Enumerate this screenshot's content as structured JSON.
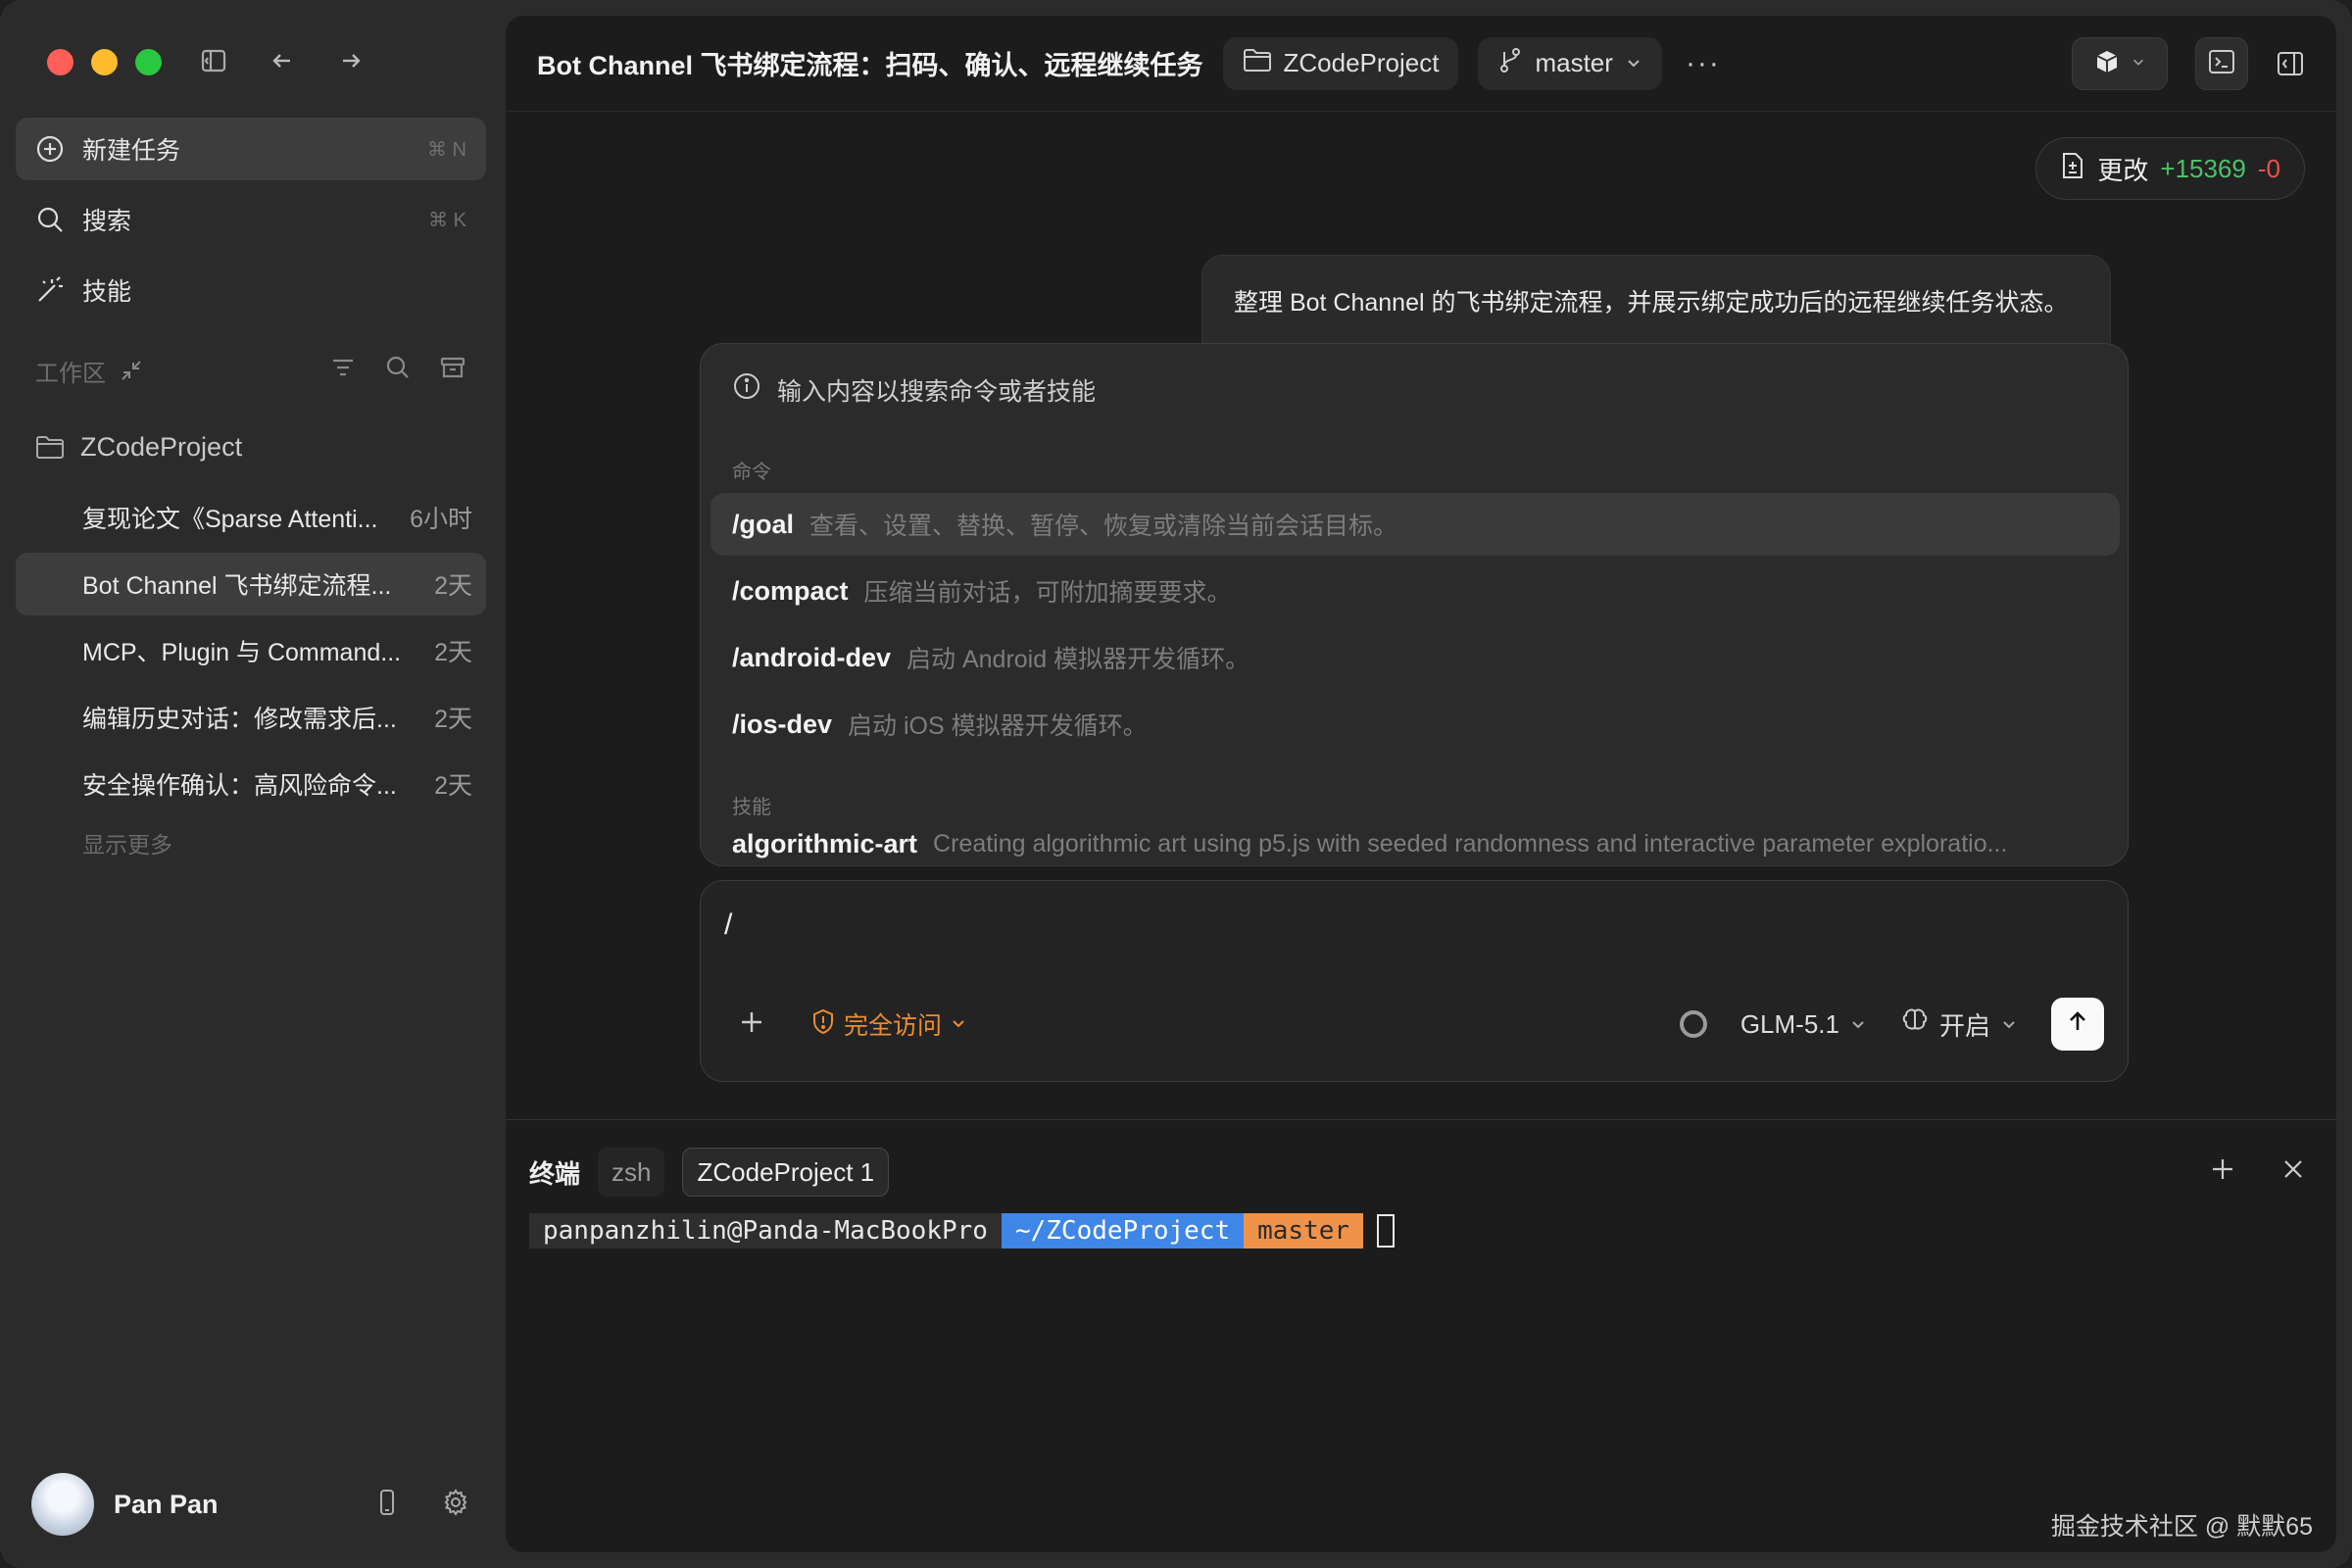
{
  "sidebar": {
    "nav": [
      {
        "label": "新建任务",
        "shortcut": "⌘ N",
        "icon": "plus-circle-icon"
      },
      {
        "label": "搜索",
        "shortcut": "⌘ K",
        "icon": "search-icon"
      },
      {
        "label": "技能",
        "shortcut": "",
        "icon": "magic-wand-icon"
      }
    ],
    "section_label": "工作区",
    "project": "ZCodeProject",
    "tasks": [
      {
        "title": "复现论文《Sparse Attenti...",
        "time": "6小时"
      },
      {
        "title": "Bot Channel 飞书绑定流程...",
        "time": "2天"
      },
      {
        "title": "MCP、Plugin 与 Command...",
        "time": "2天"
      },
      {
        "title": "编辑历史对话：修改需求后...",
        "time": "2天"
      },
      {
        "title": "安全操作确认：高风险命令...",
        "time": "2天"
      }
    ],
    "show_more": "显示更多",
    "user": {
      "name": "Pan Pan"
    }
  },
  "topbar": {
    "title": "Bot Channel 飞书绑定流程：扫码、确认、远程继续任务",
    "project": "ZCodeProject",
    "branch": "master",
    "more": "···"
  },
  "changes": {
    "label": "更改",
    "added": "+15369",
    "removed": "-0"
  },
  "user_message": "整理 Bot Channel 的飞书绑定流程，并展示绑定成功后的远程继续任务状态。",
  "palette": {
    "hint": "输入内容以搜索命令或者技能",
    "commands_label": "命令",
    "commands": [
      {
        "name": "/goal",
        "desc": "查看、设置、替换、暂停、恢复或清除当前会话目标。"
      },
      {
        "name": "/compact",
        "desc": "压缩当前对话，可附加摘要要求。"
      },
      {
        "name": "/android-dev",
        "desc": "启动 Android 模拟器开发循环。"
      },
      {
        "name": "/ios-dev",
        "desc": "启动 iOS 模拟器开发循环。"
      }
    ],
    "skills_label": "技能",
    "skills": [
      {
        "name": "algorithmic-art",
        "desc": "Creating algorithmic art using p5.js with seeded randomness and interactive parameter exploratio..."
      }
    ]
  },
  "composer": {
    "value": "/",
    "access": "完全访问",
    "model": "GLM-5.1",
    "thinking": "开启"
  },
  "terminal": {
    "title": "终端",
    "tabs": [
      "zsh",
      "ZCodeProject 1"
    ],
    "prompt_user": "panpanzhilin@Panda-MacBookPro",
    "prompt_dir": "~/ZCodeProject",
    "prompt_branch": "master"
  },
  "watermark": "掘金技术社区 @ 默默65",
  "colors": {
    "accent_orange": "#f08c2e",
    "git_added": "#4cc16b",
    "git_removed": "#e5534b",
    "dir_blue": "#3f86e6"
  }
}
